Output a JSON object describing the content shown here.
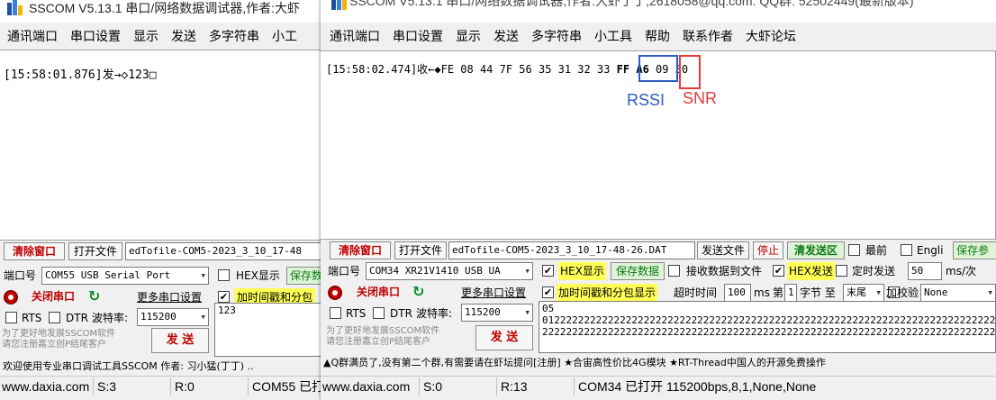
{
  "left_window": {
    "title": "SSCOM V5.13.1 串口/网络数据调试器,作者:大虾",
    "menu": [
      "通讯端口",
      "串口设置",
      "显示",
      "发送",
      "多字符串",
      "小工"
    ],
    "recv_line": "[15:58:01.876]发→◇123□",
    "toolbar": {
      "clear_label": "清除窗口",
      "open_file_label": "打开文件",
      "file_path": "edTofile-COM5-2023_3_10_17-48"
    },
    "port_label": "端口号",
    "port_value": "COM55 USB Serial Port",
    "hex_display_label": "HEX显示",
    "save_label": "保存数",
    "close_port_label": "关闭串口",
    "more_settings_label": "更多串口设置",
    "timestamp_label": "加时间戳和分包",
    "rts_label": "RTS",
    "dtr_label": "DTR",
    "baud_label": "波特率:",
    "baud_value": "115200",
    "send_text": "123",
    "promo_line1": "为了更好地发展SSCOM软件",
    "promo_line2": "请您注册嘉立创P结尾客户",
    "send_button_label": "发 送",
    "banner": "欢迎使用专业串口调试工具SSCOM  作者: 习小猛(丁丁)  ..",
    "status": {
      "website": "www.daxia.com",
      "s": "S:3",
      "r": "R:0",
      "port": "COM55 已打"
    }
  },
  "right_window": {
    "title": "SSCOM V5.13.1 串口/网络数据调试器,作者:大虾丁丁,2618058@qq.com. QQ群: 52502449(最新版本)",
    "menu": [
      "通讯端口",
      "串口设置",
      "显示",
      "发送",
      "多字符串",
      "小工具",
      "帮助",
      "联系作者",
      "大虾论坛"
    ],
    "recv_prefix": "[15:58:02.474]收←◆FE 08 44 7F 56 35 31 32 33 ",
    "recv_rssi": "FF A6",
    "recv_snr": "09",
    "recv_suffix": " 30",
    "rssi_label": "RSSI",
    "snr_label": "SNR",
    "toolbar": {
      "clear_label": "清除窗口",
      "open_file_label": "打开文件",
      "file_path": "edTofile-COM5-2023_3_10_17-48-26.DAT",
      "send_file_label": "发送文件",
      "stop_label": "停止",
      "clear_send_label": "清发送区",
      "topmost_label": "最前",
      "english_label": "Engli",
      "save_params_label": "保存参"
    },
    "port_label": "端口号",
    "port_value": "COM34 XR21V1410 USB UA",
    "hex_display_label": "HEX显示",
    "save_data_label": "保存数据",
    "recv_to_file_label": "接收数据到文件",
    "hex_send_label": "HEX发送",
    "timed_send_label": "定时发送",
    "interval_value": "50",
    "interval_unit": "ms/次",
    "close_port_label": "关闭串口",
    "more_settings_label": "更多串口设置",
    "timestamp_label": "加时间戳和分包显示",
    "timeout_label": "超时时间",
    "timeout_value": "100",
    "ms_label": "ms",
    "byte_prefix": "第",
    "byte_index": "1",
    "byte_suffix": "字节 至",
    "end_value": "末尾",
    "checksum_label": "加校验",
    "checksum_value": "None",
    "rts_label": "RTS",
    "dtr_label": "DTR",
    "baud_label": "波特率:",
    "baud_value": "115200",
    "send_text_line1": "05",
    "send_text_line2": "0122222222222222222222222222222222222222222222222222222222222222222222222222222222222",
    "send_text_line3": "2222222222222222222222222222222222222222222222222222222222222222222222222222222222222",
    "promo_line1": "为了更好地发展SSCOM软件",
    "promo_line2": "请您注册嘉立创P结尾客户",
    "send_button_label": "发 送",
    "banner": "▲Q群满员了,没有第二个群,有需要请在虾坛提问[注册]    ★合宙高性价比4G模块    ★RT-Thread中国人的开源免费操作",
    "status": {
      "website": "www.daxia.com",
      "s": "S:0",
      "r": "R:13",
      "port_info": "COM34 已打开  115200bps,8,1,None,None"
    }
  }
}
